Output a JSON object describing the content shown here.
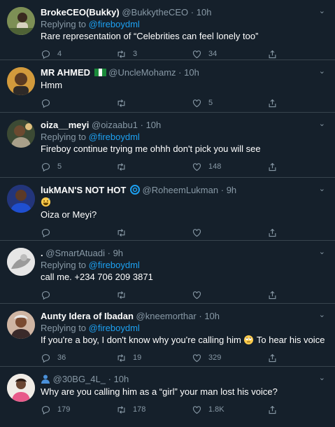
{
  "tweets": [
    {
      "name": "BrokeCEO(Bukky)",
      "handle": "@BukkytheCEO",
      "dot": "·",
      "time": "10h",
      "replying_prefix": "Replying to ",
      "replying_to": "@fireboydml",
      "text": "Rare representation of “Celebrities can feel lonely too”",
      "replies": "4",
      "retweets": "3",
      "likes": "34"
    },
    {
      "name": "MR AHMED",
      "flag_icon": "nigeria-flag-icon",
      "handle": "@UncleMohamz",
      "dot": "·",
      "time": "10h",
      "text": "Hmm",
      "replies": "",
      "retweets": "",
      "likes": "5"
    },
    {
      "name": "oiza__meyi",
      "handle": "@oizaabu1",
      "dot": "·",
      "time": "10h",
      "replying_prefix": "Replying to ",
      "replying_to": "@fireboydml",
      "text": "Fireboy continue trying me ohhh don't pick you will see",
      "replies": "5",
      "retweets": "",
      "likes": "148"
    },
    {
      "name": "lukMAN'S NOT HOT",
      "handle": "@RoheemLukman",
      "dot": "·",
      "time": "9h",
      "emoji_icon": "grinning-sweat-emoji-icon",
      "text": "Oiza or Meyi?",
      "replies": "",
      "retweets": "",
      "likes": ""
    },
    {
      "name": ".",
      "handle": "@SmartAtuadi",
      "dot": "·",
      "time": "9h",
      "replying_prefix": "Replying to ",
      "replying_to": "@fireboydml",
      "text": "call me. +234 706 209 3871",
      "replies": "",
      "retweets": "",
      "likes": ""
    },
    {
      "name": "Aunty Idera of Ibadan",
      "handle": "@kneemorthar",
      "dot": "·",
      "time": "10h",
      "replying_prefix": "Replying to ",
      "replying_to": "@fireboydml",
      "text_before": "If you're a boy, I don't know why you're calling him",
      "text_after": "To hear his voice",
      "replies": "36",
      "retweets": "19",
      "likes": "329"
    },
    {
      "name": "",
      "handle": "@30BG_4L_",
      "dot": "·",
      "time": "10h",
      "text": "Why are you calling him as a “girl” your man lost his voice?",
      "replies": "179",
      "retweets": "178",
      "likes": "1.8K"
    }
  ],
  "colors": {
    "background": "#15202b",
    "divider": "#38444d",
    "muted": "#8899a6",
    "link": "#1da1f2"
  }
}
